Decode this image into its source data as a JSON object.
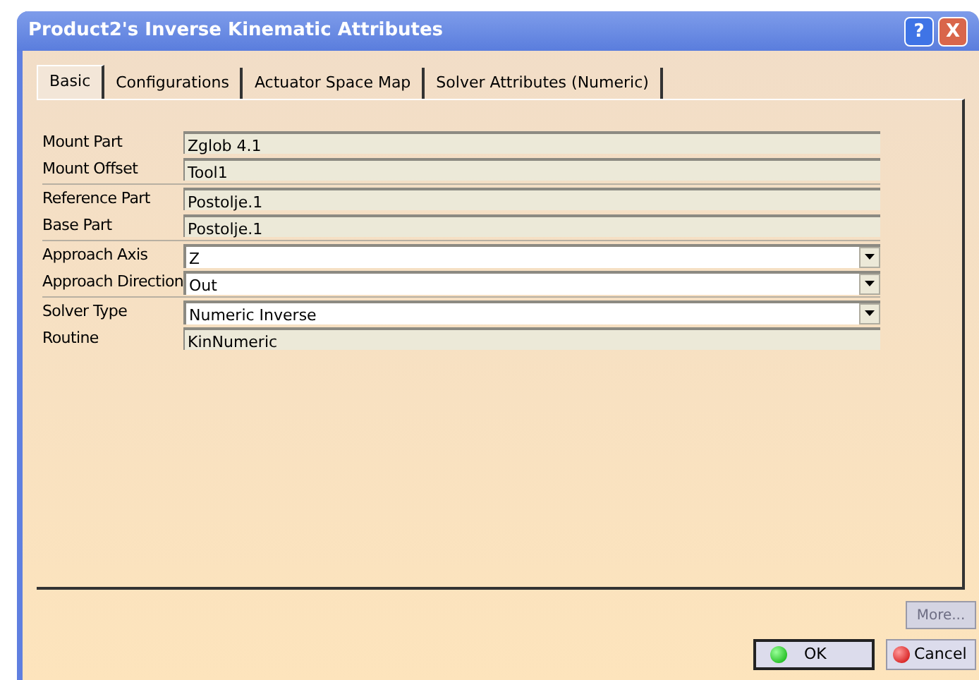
{
  "window": {
    "title": "Product2's Inverse Kinematic Attributes",
    "help": "?",
    "close": "X"
  },
  "tabs": [
    {
      "label": "Basic",
      "selected": true
    },
    {
      "label": "Configurations",
      "selected": false
    },
    {
      "label": "Actuator Space Map",
      "selected": false
    },
    {
      "label": "Solver Attributes (Numeric)",
      "selected": false
    }
  ],
  "groups": [
    [
      {
        "label": "Mount Part",
        "value": "Zglob 4.1",
        "kind": "readonly"
      },
      {
        "label": "Mount Offset",
        "value": "Tool1",
        "kind": "readonly"
      }
    ],
    [
      {
        "label": "Reference Part",
        "value": "Postolje.1",
        "kind": "readonly"
      },
      {
        "label": "Base Part",
        "value": "Postolje.1",
        "kind": "readonly"
      }
    ],
    [
      {
        "label": "Approach Axis",
        "value": "Z",
        "kind": "combo"
      },
      {
        "label": "Approach Direction",
        "value": "Out",
        "kind": "combo"
      }
    ],
    [
      {
        "label": "Solver Type",
        "value": "Numeric Inverse",
        "kind": "combo"
      },
      {
        "label": "Routine",
        "value": "KinNumeric",
        "kind": "readonly"
      }
    ]
  ],
  "buttons": {
    "more": {
      "label": "More...",
      "disabled": true
    },
    "ok": "OK",
    "cancel": "Cancel"
  }
}
